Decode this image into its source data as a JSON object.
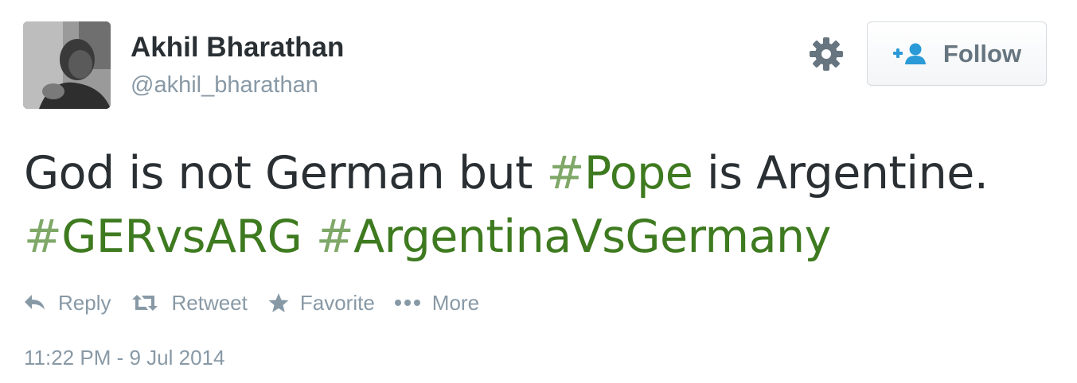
{
  "user": {
    "display_name": "Akhil Bharathan",
    "handle": "@akhil_bharathan",
    "avatar_icon": "user-avatar-photo"
  },
  "header": {
    "settings_icon": "gear-icon",
    "follow_label": "Follow",
    "follow_icon": "add-user-icon"
  },
  "tweet": {
    "text_1": "God is not German but ",
    "hashtag_pope_symbol": "#",
    "hashtag_pope": "Pope",
    "text_2": " is Argentine.",
    "hashtag_ger_symbol": "#",
    "hashtag_ger": "GERvsARG",
    "hashtag_arg_symbol": "#",
    "hashtag_arg": "ArgentinaVsGermany"
  },
  "actions": {
    "reply": "Reply",
    "retweet": "Retweet",
    "favorite": "Favorite",
    "more": "More"
  },
  "timestamp": "11:22 PM - 9 Jul 2014",
  "colors": {
    "hashtag": "#3e7a1f",
    "muted": "#8899a6",
    "text": "#292f33"
  }
}
